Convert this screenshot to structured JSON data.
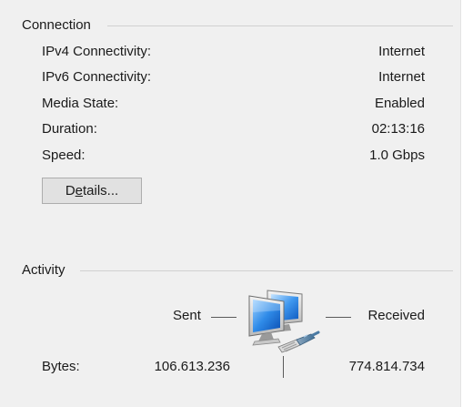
{
  "connection": {
    "title": "Connection",
    "rows": [
      {
        "label": "IPv4 Connectivity:",
        "value": "Internet"
      },
      {
        "label": "IPv6 Connectivity:",
        "value": "Internet"
      },
      {
        "label": "Media State:",
        "value": "Enabled"
      },
      {
        "label": "Duration:",
        "value": "02:13:16"
      },
      {
        "label": "Speed:",
        "value": "1.0 Gbps"
      }
    ],
    "details_button": {
      "prefix": "D",
      "mnemonic": "e",
      "suffix": "tails..."
    }
  },
  "activity": {
    "title": "Activity",
    "sent_label": "Sent",
    "received_label": "Received",
    "bytes_label": "Bytes:",
    "bytes_sent": "106.613.236",
    "bytes_received": "774.814.734",
    "icon": "network-computers-icon"
  }
}
